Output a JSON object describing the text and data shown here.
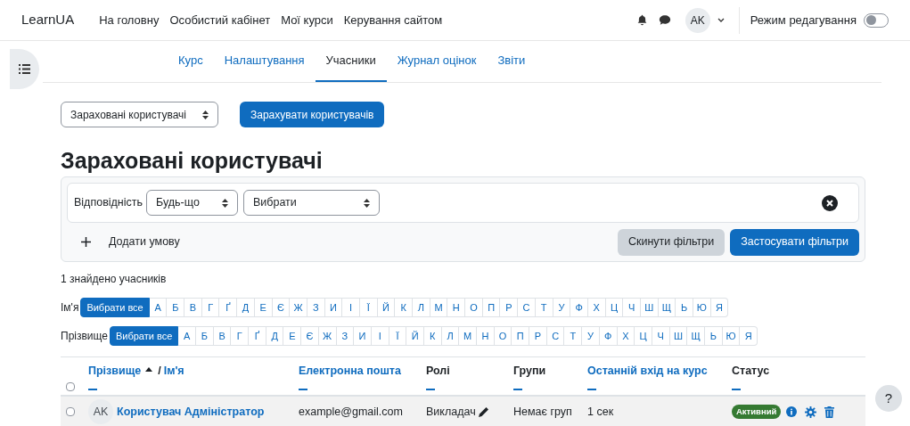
{
  "navbar": {
    "brand": "LearnUA",
    "links": [
      "На головну",
      "Особистий кабінет",
      "Мої курси",
      "Керування сайтом"
    ],
    "avatar": "AK",
    "edit_mode": {
      "label": "Режим редагування",
      "on": false
    }
  },
  "tabs": [
    {
      "label": "Курс",
      "selected": false
    },
    {
      "label": "Налаштування",
      "selected": false
    },
    {
      "label": "Учасники",
      "selected": true
    },
    {
      "label": "Журнал оцінок",
      "selected": false
    },
    {
      "label": "Звіти",
      "selected": false
    }
  ],
  "page_select": {
    "value": "Зараховані користувачі"
  },
  "enrol_button": "Зарахувати користувачів",
  "heading": "Зараховані користувачі",
  "filter": {
    "match_label": "Відповідність",
    "match_value": "Будь-що",
    "type_value": "Вибрати",
    "add_condition": "Додати умову",
    "reset": "Скинути фільтри",
    "apply": "Застосувати фільтри"
  },
  "found": "1 знайдено учасників",
  "initials_bars": [
    {
      "label": "Ім'я",
      "all": "Вибрати все",
      "all_selected": true,
      "letters": [
        "А",
        "Б",
        "В",
        "Г",
        "Ґ",
        "Д",
        "Е",
        "Є",
        "Ж",
        "З",
        "И",
        "І",
        "Ї",
        "Й",
        "К",
        "Л",
        "М",
        "Н",
        "О",
        "П",
        "Р",
        "С",
        "Т",
        "У",
        "Ф",
        "Х",
        "Ц",
        "Ч",
        "Ш",
        "Щ",
        "Ь",
        "Ю",
        "Я"
      ]
    },
    {
      "label": "Прізвище",
      "all": "Вибрати все",
      "all_selected": true,
      "letters": [
        "А",
        "Б",
        "В",
        "Г",
        "Ґ",
        "Д",
        "Е",
        "Є",
        "Ж",
        "З",
        "И",
        "І",
        "Ї",
        "Й",
        "К",
        "Л",
        "М",
        "Н",
        "О",
        "П",
        "Р",
        "С",
        "Т",
        "У",
        "Ф",
        "Х",
        "Ц",
        "Ч",
        "Ш",
        "Щ",
        "Ь",
        "Ю",
        "Я"
      ]
    }
  ],
  "table": {
    "select_all_checked": false,
    "columns": [
      {
        "label": "Прізвище",
        "separator": "/",
        "second": "Ім'я",
        "link": true,
        "sorted": true
      },
      {
        "label": "Електронна пошта",
        "link": true,
        "sorted": false
      },
      {
        "label": "Ролі",
        "link": false,
        "sorted": false
      },
      {
        "label": "Групи",
        "link": false,
        "sorted": false
      },
      {
        "label": "Останній вхід на курс",
        "link": true,
        "sorted": false
      },
      {
        "label": "Статус",
        "link": false,
        "sorted": false
      }
    ],
    "rows": [
      {
        "checked": false,
        "avatar": "AK",
        "name": "Користувач Адміністратор",
        "email": "example@gmail.com",
        "role": "Викладач",
        "groups": "Немає груп",
        "last_access": "1 сек",
        "status": "Активний"
      }
    ]
  },
  "help": "?"
}
